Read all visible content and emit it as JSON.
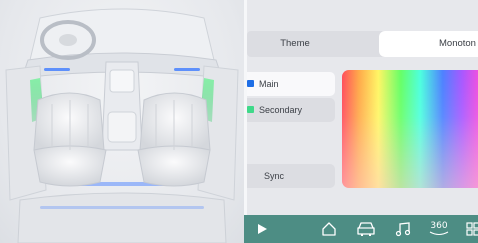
{
  "car_view": {
    "name": "car-interior-render"
  },
  "settings": {
    "tabs": [
      {
        "label": "Theme",
        "selected": false
      },
      {
        "label": "Monoton",
        "selected": true
      }
    ],
    "zones": [
      {
        "label": "Main",
        "color": "#1e6ee6",
        "selected": true
      },
      {
        "label": "Secondary",
        "color": "#3fd98a",
        "selected": false
      }
    ],
    "sync_label": "Sync"
  },
  "dock": {
    "background": "#4d8d84",
    "items": [
      {
        "icon": "play-icon"
      },
      {
        "icon": "home-icon"
      },
      {
        "icon": "car-icon"
      },
      {
        "icon": "music-note-icon"
      },
      {
        "icon": "360-view-icon",
        "label": "360"
      },
      {
        "icon": "grid-icon"
      }
    ]
  }
}
